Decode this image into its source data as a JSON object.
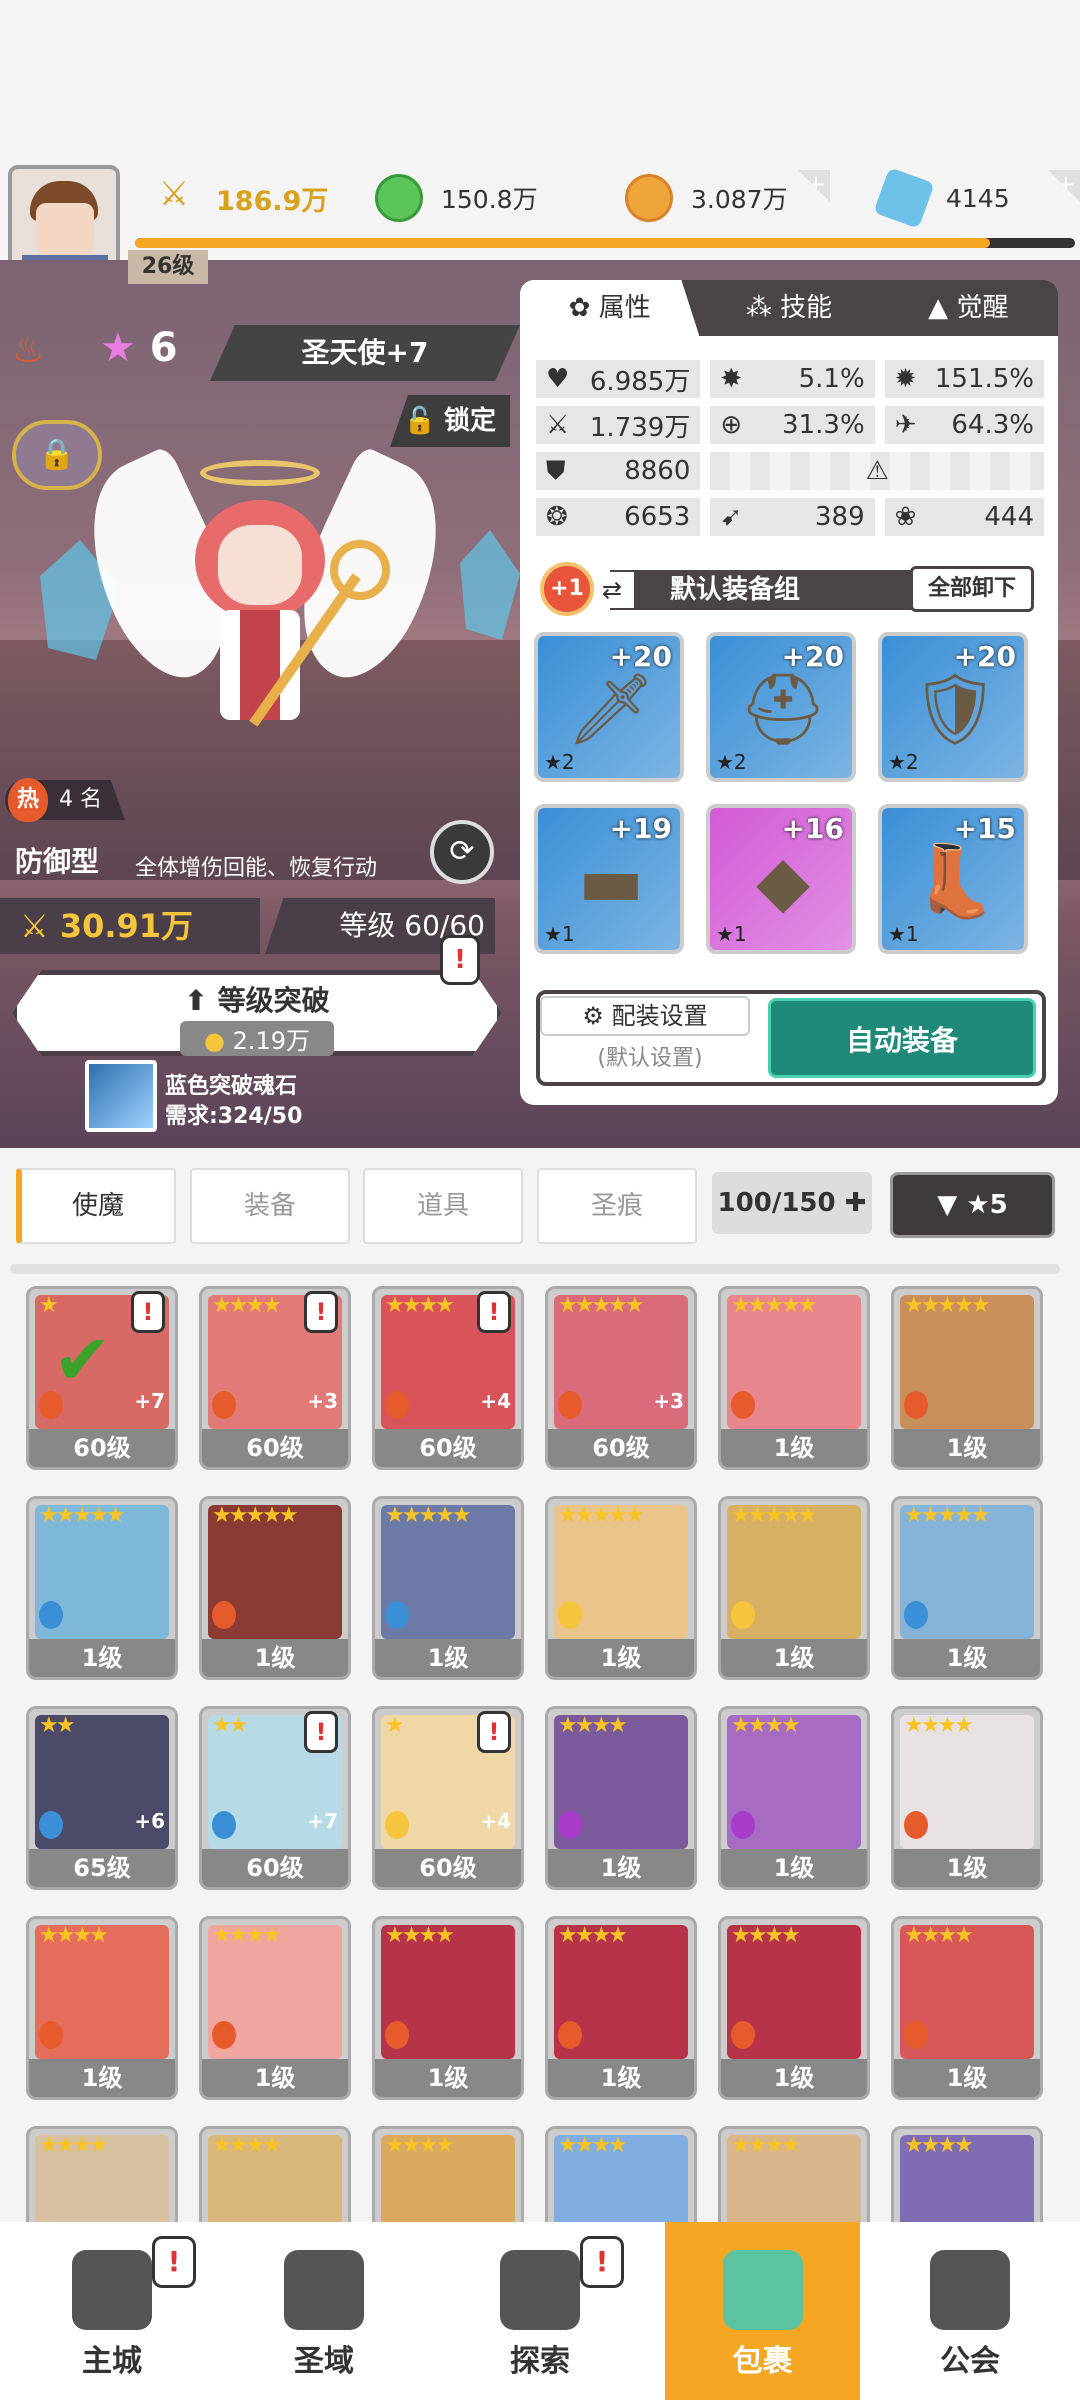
{
  "header": {
    "level": "26级",
    "power": "186.9万",
    "green": "150.8万",
    "gold": "3.087万",
    "gem": "4145"
  },
  "hero": {
    "star": "6",
    "name": "圣天使+7",
    "lock": "锁定",
    "rank": "4 名",
    "heat_char": "热",
    "role": "防御型",
    "role_desc": "全体增伤回能、恢复行动",
    "power": "30.91万",
    "level": "等级 60/60",
    "break_title": "等级突破",
    "break_cost": "2.19万",
    "soul_name": "蓝色突破魂石",
    "soul_req": "需求:324/50"
  },
  "panel": {
    "tabs": [
      "属性",
      "技能",
      "觉醒"
    ],
    "stats": {
      "hp": "6.985万",
      "crit": "5.1%",
      "critdmg": "151.5%",
      "atk": "1.739万",
      "hit": "31.3%",
      "dodge": "64.3%",
      "def": "8860",
      "spd": "6653",
      "pen": "389",
      "res": "444"
    },
    "set": {
      "badge": "+1",
      "name": "默认装备组",
      "unequip": "全部卸下"
    },
    "equip": [
      {
        "lvl": "+20",
        "stars": "★2",
        "color": "#3a8fd6"
      },
      {
        "lvl": "+20",
        "stars": "★2",
        "color": "#3a8fd6"
      },
      {
        "lvl": "+20",
        "stars": "★2",
        "color": "#3a8fd6"
      },
      {
        "lvl": "+19",
        "stars": "★1",
        "color": "#3a8fd6"
      },
      {
        "lvl": "+16",
        "stars": "★1",
        "color": "#d35ad6"
      },
      {
        "lvl": "+15",
        "stars": "★1",
        "color": "#3a8fd6"
      }
    ],
    "cfg": "配装设置",
    "cfg_sub": "(默认设置)",
    "auto": "自动装备"
  },
  "tabs": [
    "使魔",
    "装备",
    "道具",
    "圣痕"
  ],
  "count": "100/150",
  "filter": "▼ ★5",
  "cards": [
    {
      "lv": "60级",
      "stars": "★",
      "plus": "+7",
      "elem": "#e65b2b",
      "alert": true,
      "check": true,
      "face": "#d86a66"
    },
    {
      "lv": "60级",
      "stars": "★★★★",
      "plus": "+3",
      "elem": "#e65b2b",
      "alert": true,
      "face": "#e27a78"
    },
    {
      "lv": "60级",
      "stars": "★★★★",
      "plus": "+4",
      "elem": "#e65b2b",
      "alert": true,
      "face": "#d9535a"
    },
    {
      "lv": "60级",
      "stars": "★★★★★",
      "plus": "+3",
      "elem": "#e65b2b",
      "face": "#d96b7a"
    },
    {
      "lv": "1级",
      "stars": "★★★★★",
      "plus": "",
      "elem": "#e65b2b",
      "face": "#e7868c"
    },
    {
      "lv": "1级",
      "stars": "★★★★★",
      "plus": "",
      "elem": "#e65b2b",
      "face": "#c98f5a"
    },
    {
      "lv": "1级",
      "stars": "★★★★★",
      "plus": "",
      "elem": "#3a8fd6",
      "face": "#7fb9d9"
    },
    {
      "lv": "1级",
      "stars": "★★★★★",
      "plus": "",
      "elem": "#e65b2b",
      "face": "#8b3a34"
    },
    {
      "lv": "1级",
      "stars": "★★★★★",
      "plus": "",
      "elem": "#3a8fd6",
      "face": "#6d7aa8"
    },
    {
      "lv": "1级",
      "stars": "★★★★★",
      "plus": "",
      "elem": "#f5c53d",
      "face": "#e9c58b"
    },
    {
      "lv": "1级",
      "stars": "★★★★★",
      "plus": "",
      "elem": "#f5c53d",
      "face": "#d8b063"
    },
    {
      "lv": "1级",
      "stars": "★★★★★",
      "plus": "",
      "elem": "#3a8fd6",
      "face": "#86b4d9"
    },
    {
      "lv": "65级",
      "stars": "★★",
      "plus": "+6",
      "elem": "#3a8fd6",
      "face": "#4b4a68"
    },
    {
      "lv": "60级",
      "stars": "★★",
      "plus": "+7",
      "elem": "#3a8fd6",
      "alert": true,
      "face": "#b7dbe6"
    },
    {
      "lv": "60级",
      "stars": "★",
      "plus": "+4",
      "elem": "#f5c53d",
      "alert": true,
      "face": "#efd8a6"
    },
    {
      "lv": "1级",
      "stars": "★★★★",
      "plus": "",
      "elem": "#a63cc9",
      "face": "#7b5a9c"
    },
    {
      "lv": "1级",
      "stars": "★★★★",
      "plus": "",
      "elem": "#a63cc9",
      "face": "#a66bc2"
    },
    {
      "lv": "1级",
      "stars": "★★★★",
      "plus": "",
      "elem": "#e65b2b",
      "face": "#e8e2e4"
    },
    {
      "lv": "1级",
      "stars": "★★★★",
      "plus": "",
      "elem": "#e65b2b",
      "face": "#e56d5c"
    },
    {
      "lv": "1级",
      "stars": "★★★★",
      "plus": "",
      "elem": "#e65b2b",
      "face": "#f0a6a0"
    },
    {
      "lv": "1级",
      "stars": "★★★★",
      "plus": "",
      "elem": "#e65b2b",
      "face": "#b6334a"
    },
    {
      "lv": "1级",
      "stars": "★★★★",
      "plus": "",
      "elem": "#e65b2b",
      "face": "#b6334a"
    },
    {
      "lv": "1级",
      "stars": "★★★★",
      "plus": "",
      "elem": "#e65b2b",
      "face": "#b6334a"
    },
    {
      "lv": "1级",
      "stars": "★★★★",
      "plus": "",
      "elem": "#e65b2b",
      "face": "#d8585a"
    },
    {
      "lv": "",
      "stars": "★★★★",
      "plus": "",
      "elem": "",
      "face": "#d6c0a0"
    },
    {
      "lv": "",
      "stars": "★★★★",
      "plus": "",
      "elem": "",
      "face": "#d7b77c"
    },
    {
      "lv": "",
      "stars": "★★★★",
      "plus": "",
      "elem": "",
      "face": "#d9a861"
    },
    {
      "lv": "",
      "stars": "★★★★",
      "plus": "",
      "elem": "",
      "face": "#80aee0"
    },
    {
      "lv": "",
      "stars": "★★★★",
      "plus": "",
      "elem": "",
      "face": "#d9b58b"
    },
    {
      "lv": "",
      "stars": "★★★★",
      "plus": "",
      "elem": "",
      "face": "#7f6cb3"
    }
  ],
  "nav": [
    "主城",
    "圣域",
    "探索",
    "包裹",
    "公会"
  ]
}
